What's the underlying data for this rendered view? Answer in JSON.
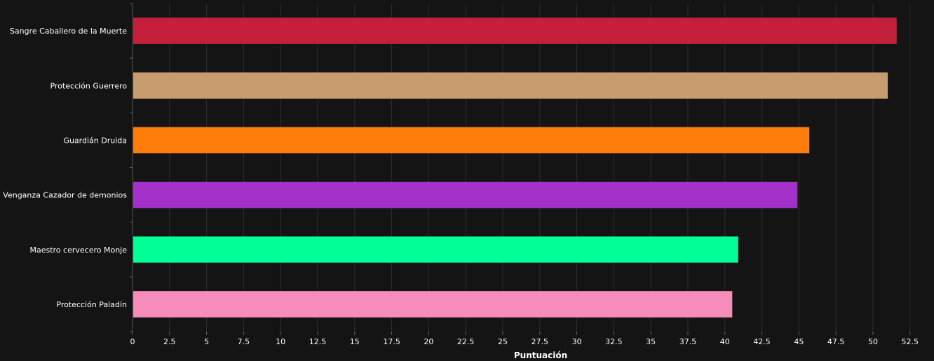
{
  "chart_data": {
    "type": "bar",
    "orientation": "horizontal",
    "categories": [
      "Sangre Caballero de la Muerte",
      "Protección Guerrero",
      "Guardián Druida",
      "Venganza Cazador de demonios",
      "Maestro cervecero Monje",
      "Protección Paladín"
    ],
    "values": [
      51.6,
      51.0,
      45.7,
      44.9,
      40.9,
      40.5
    ],
    "colors": [
      "#c41f3b",
      "#c79c6e",
      "#ff7d0a",
      "#a330c9",
      "#00ff96",
      "#f58cba"
    ],
    "xlabel": "Puntuación",
    "ylabel": "",
    "title": "",
    "xlim": [
      0,
      53.6
    ],
    "ticks": [
      0,
      2.5,
      5,
      7.5,
      10,
      12.5,
      15,
      17.5,
      20,
      22.5,
      25,
      27.5,
      30,
      32.5,
      35,
      37.5,
      40,
      42.5,
      45,
      47.5,
      50,
      52.5
    ],
    "tick_labels": [
      "0",
      "2.5",
      "5",
      "7.5",
      "10",
      "12.5",
      "15",
      "17.5",
      "20",
      "22.5",
      "25",
      "27.5",
      "30",
      "32.5",
      "35",
      "37.5",
      "40",
      "42.5",
      "45",
      "47.5",
      "50",
      "52.5"
    ],
    "grid": true,
    "background": "#141414",
    "grid_color": "#2e2e2e",
    "text_color": "#ffffff"
  }
}
